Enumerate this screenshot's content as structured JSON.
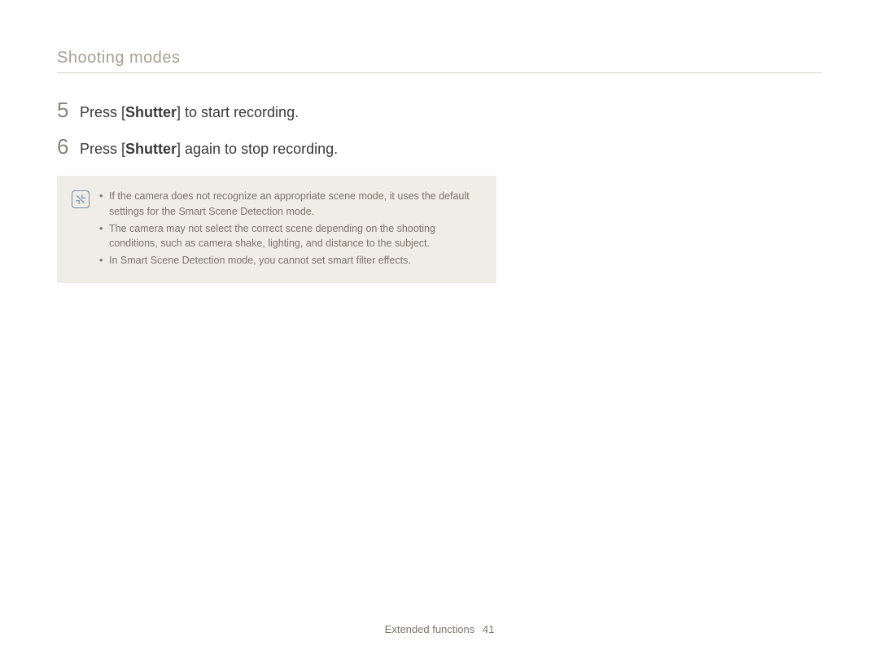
{
  "header": {
    "section_title": "Shooting modes"
  },
  "steps": [
    {
      "number": "5",
      "prefix": "Press [",
      "bold": "Shutter",
      "suffix": "] to start recording."
    },
    {
      "number": "6",
      "prefix": "Press [",
      "bold": "Shutter",
      "suffix": "] again to stop recording."
    }
  ],
  "note": {
    "icon_name": "note-icon",
    "items": [
      "If the camera does not recognize an appropriate scene mode, it uses the default settings for the Smart Scene Detection mode.",
      "The camera may not select the correct scene depending on the shooting conditions, such as camera shake, lighting, and distance to the subject.",
      "In Smart Scene Detection mode, you cannot set smart filter effects."
    ]
  },
  "footer": {
    "label": "Extended functions",
    "page": "41"
  }
}
